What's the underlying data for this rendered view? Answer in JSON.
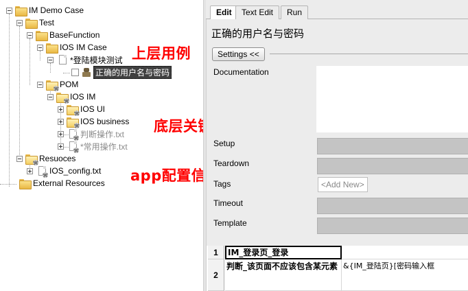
{
  "tree": {
    "items": [
      {
        "label": "IM Demo Case"
      },
      {
        "label": "Test"
      },
      {
        "label": "BaseFunction"
      },
      {
        "label": "IOS IM Case"
      },
      {
        "label": "*登陆模块测试"
      },
      {
        "label": "正确的用户名与密码"
      },
      {
        "label": "POM"
      },
      {
        "label": "IOS IM"
      },
      {
        "label": "IOS UI"
      },
      {
        "label": "IOS business"
      },
      {
        "label": "判断操作.txt"
      },
      {
        "label": "*常用操作.txt"
      },
      {
        "label": "Resuoces"
      },
      {
        "label": "IOS_config.txt"
      },
      {
        "label": "External Resources"
      }
    ]
  },
  "annotations": {
    "upper_case": "上层用例",
    "bottom_keyword": "底层关键字",
    "app_config": "app配置信息"
  },
  "editor": {
    "tabs": [
      {
        "label": "Edit"
      },
      {
        "label": "Text Edit"
      },
      {
        "label": "Run"
      }
    ],
    "title": "正确的用户名与密码",
    "settings_button": "Settings <<",
    "fields": {
      "documentation": "Documentation",
      "setup": "Setup",
      "teardown": "Teardown",
      "tags": "Tags",
      "add_new": "<Add New>",
      "timeout": "Timeout",
      "template": "Template"
    },
    "grid": {
      "rows": [
        {
          "num": "1",
          "col1": "IM_登录页_登录",
          "col2": ""
        },
        {
          "num": "2",
          "col1": "判断_该页面不应该包含某元素",
          "col2": "&{IM_登陆页}[密码输入框"
        }
      ]
    }
  },
  "colors": {
    "annotation": "#ff0000",
    "selected_bg": "#404040",
    "panel_bg": "#ececec",
    "field_bar": "#c4c4c4"
  }
}
